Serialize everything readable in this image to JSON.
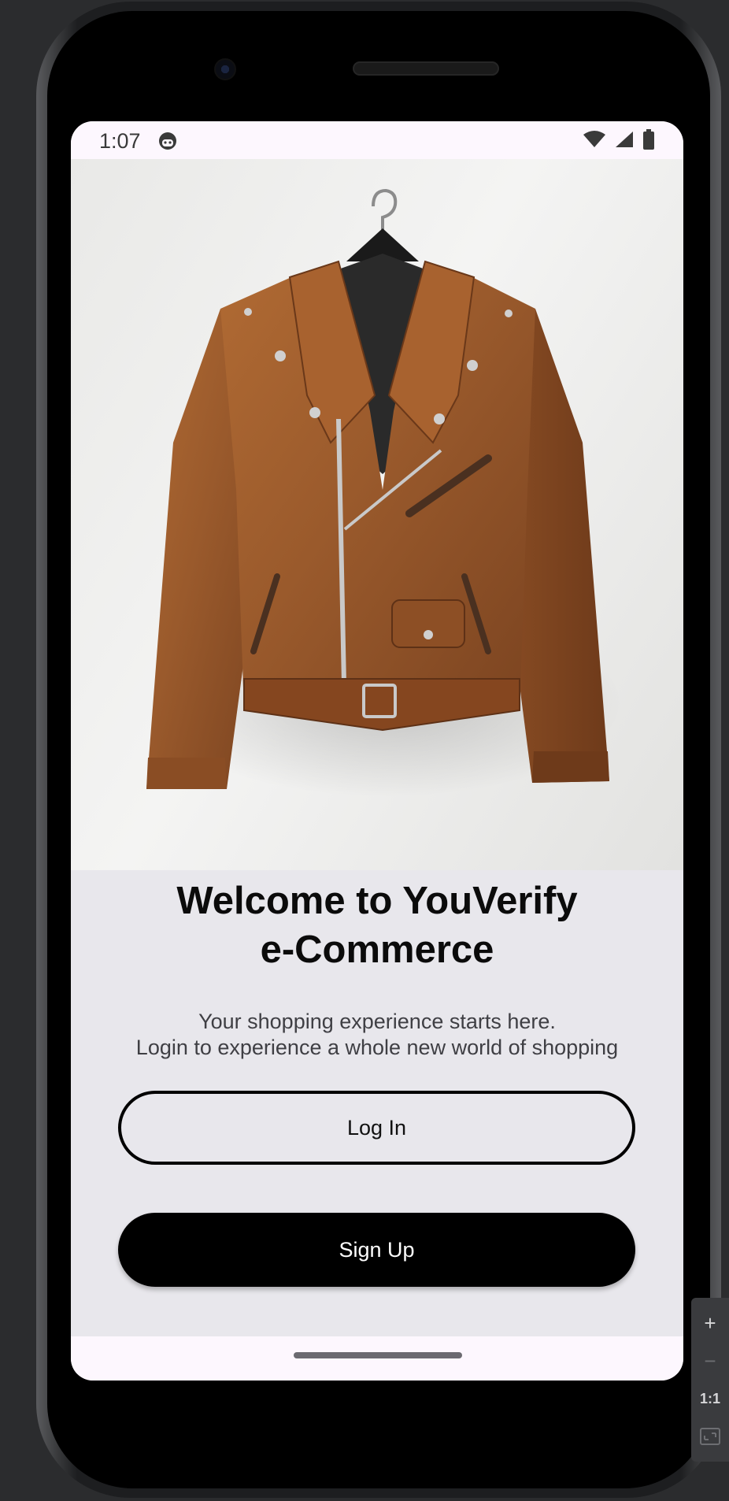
{
  "status_bar": {
    "time": "1:07",
    "icons": [
      "wifi-icon",
      "signal-icon",
      "battery-icon"
    ],
    "notification_icon": "android-face-icon"
  },
  "hero": {
    "image_subject": "brown leather biker jacket on a hanger"
  },
  "welcome": {
    "title_line1": "Welcome to YouVerify",
    "title_line2": "e-Commerce",
    "subtitle_line1": "Your shopping experience starts here.",
    "subtitle_line2": "Login to experience a whole new world of shopping"
  },
  "buttons": {
    "login_label": "Log In",
    "signup_label": "Sign Up"
  },
  "emulator_controls": {
    "zoom_in": "+",
    "zoom_out": "−",
    "actual_size": "1:1"
  },
  "colors": {
    "accent": "#000000",
    "screen_background": "#e8e7ec",
    "status_bar_background": "#fdf7fe",
    "jacket_brown": "#9a5a2c"
  }
}
